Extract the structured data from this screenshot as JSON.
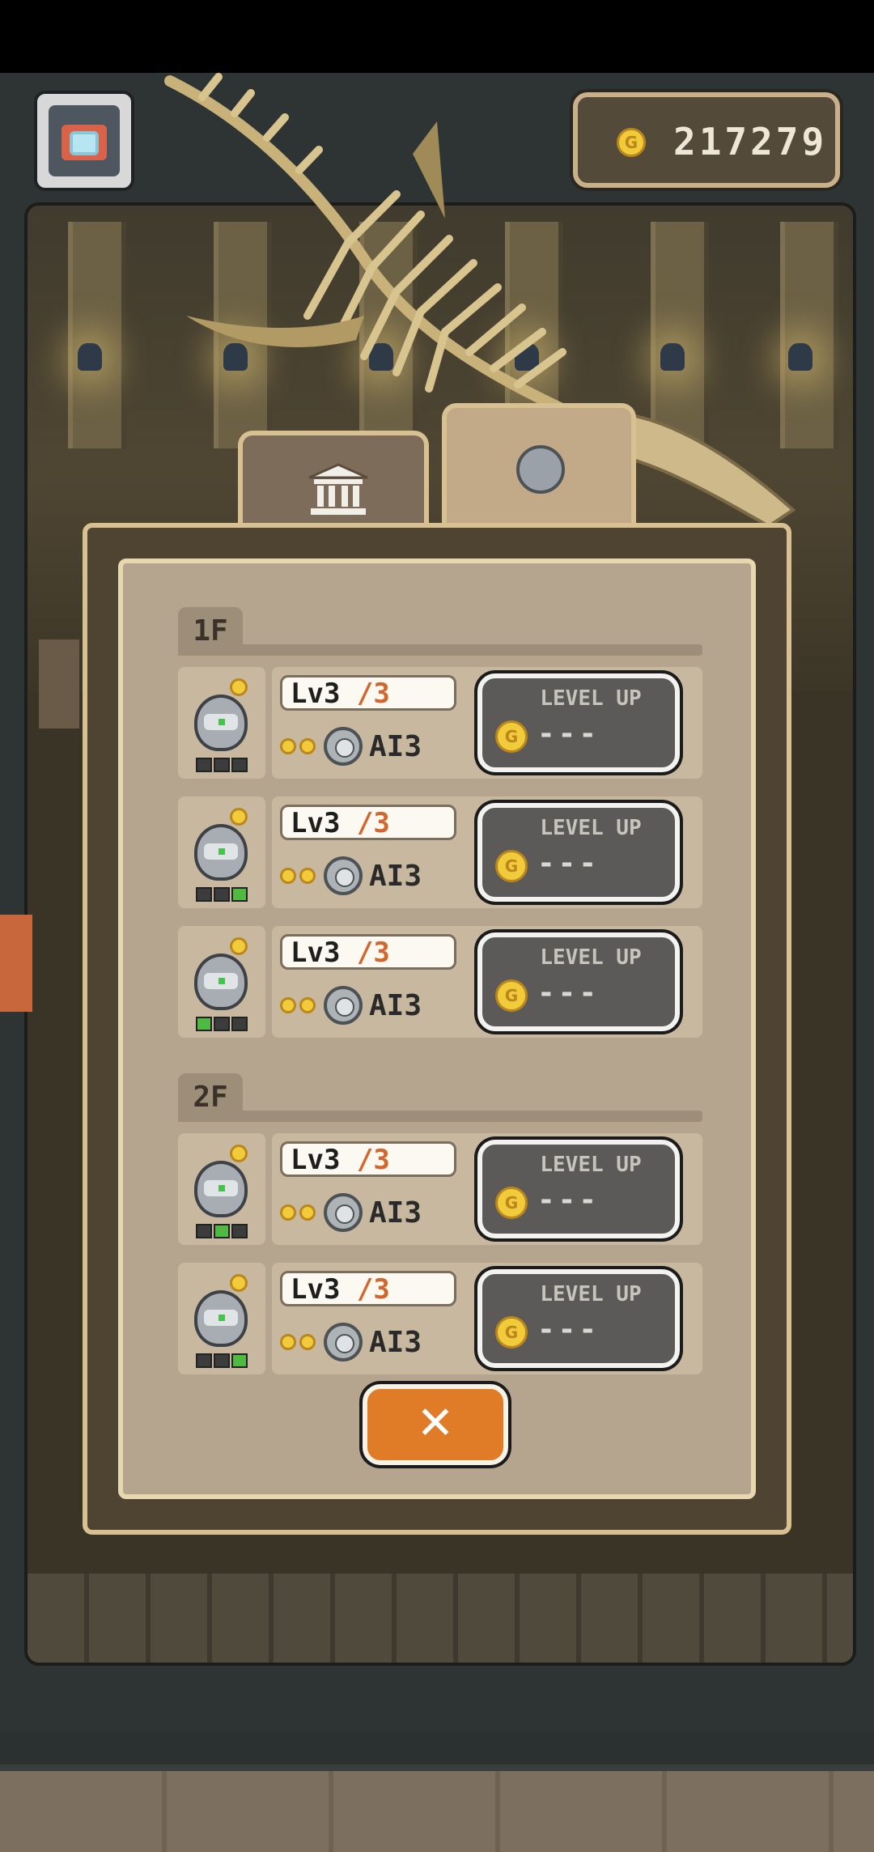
{
  "hud": {
    "coins": "217279"
  },
  "tabs": [
    {
      "name": "museum-tab"
    },
    {
      "name": "robot-tab"
    }
  ],
  "floors": [
    {
      "label": "1F",
      "robots": [
        {
          "level": "Lv3",
          "max": "/3",
          "ai": "AI3",
          "button": "LEVEL UP",
          "price": "---",
          "lit_dots": [
            false,
            false,
            false
          ]
        },
        {
          "level": "Lv3",
          "max": "/3",
          "ai": "AI3",
          "button": "LEVEL UP",
          "price": "---",
          "lit_dots": [
            false,
            false,
            true
          ]
        },
        {
          "level": "Lv3",
          "max": "/3",
          "ai": "AI3",
          "button": "LEVEL UP",
          "price": "---",
          "lit_dots": [
            true,
            false,
            false
          ]
        }
      ]
    },
    {
      "label": "2F",
      "robots": [
        {
          "level": "Lv3",
          "max": "/3",
          "ai": "AI3",
          "button": "LEVEL UP",
          "price": "---",
          "lit_dots": [
            false,
            true,
            false
          ]
        },
        {
          "level": "Lv3",
          "max": "/3",
          "ai": "AI3",
          "button": "LEVEL UP",
          "price": "---",
          "lit_dots": [
            false,
            false,
            true
          ]
        }
      ]
    }
  ],
  "close_label": "✕",
  "colors": {
    "panel_bg": "#b5a58e",
    "accent_orange": "#e07c28",
    "level_max": "#d3662c",
    "coin": "#f1cb3a"
  }
}
